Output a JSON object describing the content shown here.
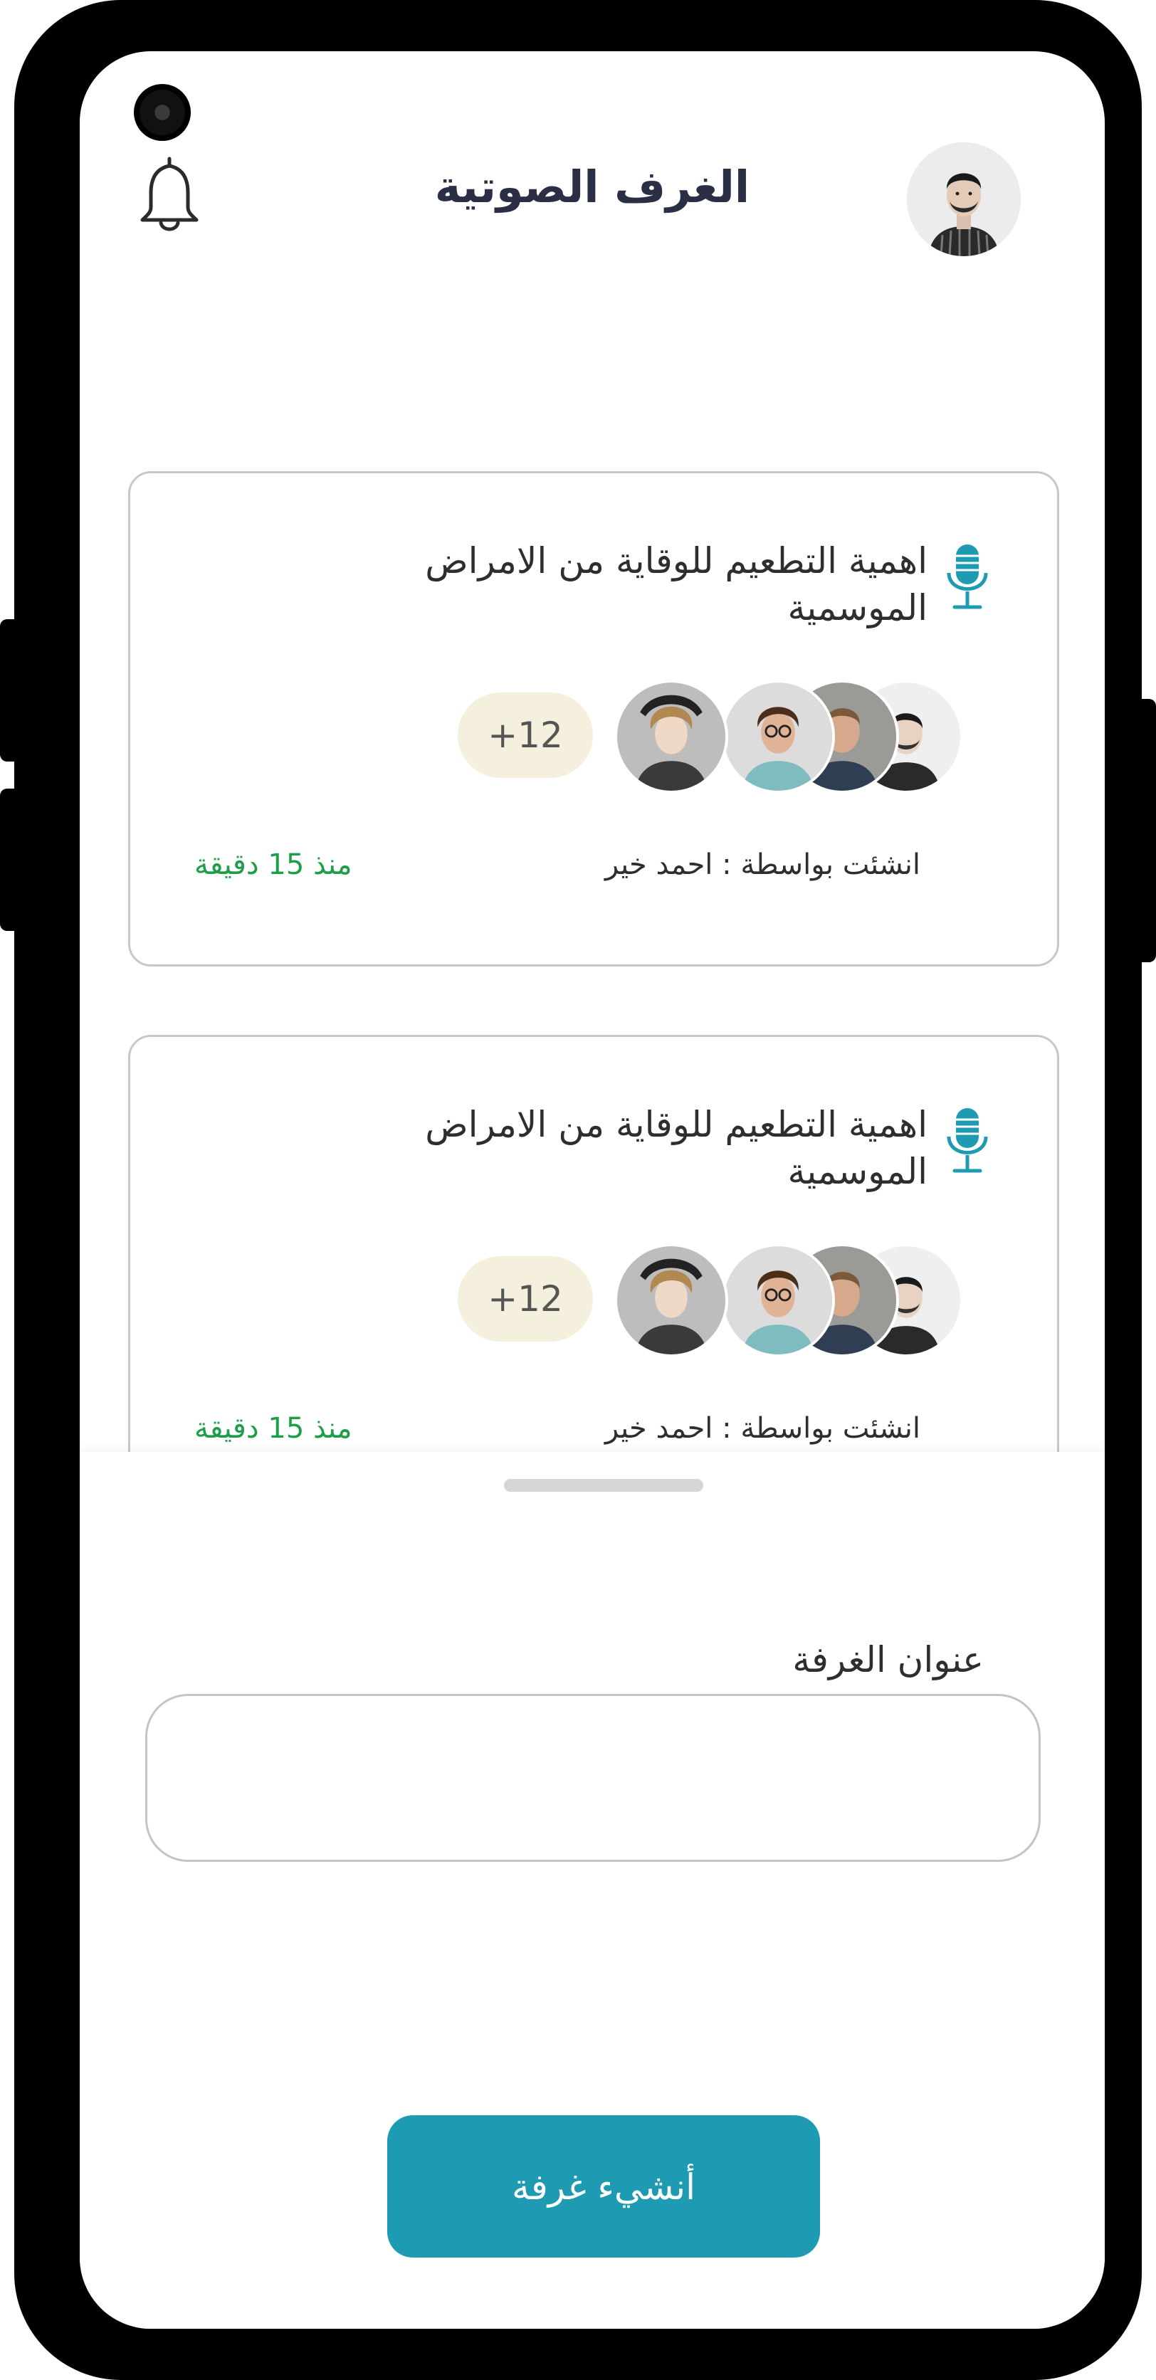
{
  "header": {
    "title": "الغرف الصوتية",
    "avatar_icon": "user-avatar",
    "notification_icon": "bell-icon"
  },
  "rooms": [
    {
      "title": "اهمية التطعيم للوقاية من الامراض الموسمية",
      "icon": "microphone-icon",
      "extra_participants": "+12",
      "created_by": "انشئت بواسطة :  احمد خير",
      "time_ago": "منذ 15 دقيقة"
    },
    {
      "title": "اهمية التطعيم للوقاية من الامراض الموسمية",
      "icon": "microphone-icon",
      "extra_participants": "+12",
      "created_by": "انشئت بواسطة :  احمد خير",
      "time_ago": "منذ 15 دقيقة"
    }
  ],
  "create_sheet": {
    "field_label": "عنوان الغرفة",
    "field_value": "",
    "field_placeholder": "",
    "submit_label": "أنشيء غرفة"
  },
  "colors": {
    "accent": "#1e9bb3",
    "title_text": "#2b2f45",
    "time_green": "#1f9e4a",
    "badge_bg": "#f4f0dd",
    "card_border": "#c8c8c8"
  }
}
